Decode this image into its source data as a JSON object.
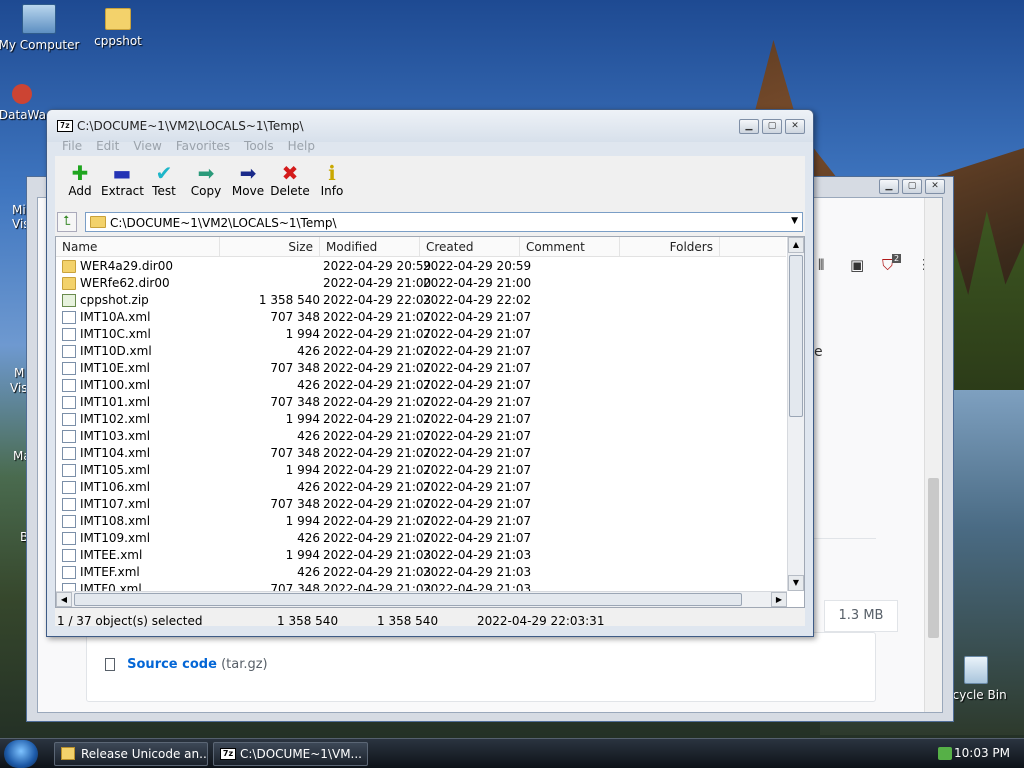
{
  "desktop": {
    "icons": [
      {
        "label": "My Computer",
        "icon": "computer-icon"
      },
      {
        "label": "cppshot",
        "icon": "folder-icon"
      },
      {
        "label": "DataWa",
        "icon": "app-icon"
      },
      {
        "label": "ecycle Bin",
        "icon": "recycle-bin-icon"
      }
    ],
    "partial_labels": [
      "Mi",
      "Vis",
      "M",
      "Vis",
      "Ma",
      "B"
    ]
  },
  "background_window": {
    "size_label": "1.3 MB",
    "source_code_label": "Source code",
    "source_code_type": "(tar.gz)",
    "cut_text": "e",
    "badge": "2"
  },
  "window": {
    "title": "C:\\DOCUME~1\\VM2\\LOCALS~1\\Temp\\",
    "app_icon_text": "7z",
    "menu": [
      "File",
      "Edit",
      "View",
      "Favorites",
      "Tools",
      "Help"
    ],
    "toolbar": [
      {
        "label": "Add",
        "icon": "plus-icon",
        "glyph": "✚",
        "color": "#1fa51f"
      },
      {
        "label": "Extract",
        "icon": "minus-icon",
        "glyph": "▬",
        "color": "#2433b5"
      },
      {
        "label": "Test",
        "icon": "check-icon",
        "glyph": "✔",
        "color": "#1eb6c9"
      },
      {
        "label": "Copy",
        "icon": "copy-arrow-icon",
        "glyph": "➡",
        "color": "#2a9a7a"
      },
      {
        "label": "Move",
        "icon": "move-arrow-icon",
        "glyph": "➡",
        "color": "#1a2a8a"
      },
      {
        "label": "Delete",
        "icon": "delete-x-icon",
        "glyph": "✖",
        "color": "#d41b1b"
      },
      {
        "label": "Info",
        "icon": "info-icon",
        "glyph": "ℹ",
        "color": "#c9a800"
      }
    ],
    "address": "C:\\DOCUME~1\\VM2\\LOCALS~1\\Temp\\",
    "columns": [
      "Name",
      "Size",
      "Modified",
      "Created",
      "Comment",
      "Folders"
    ],
    "files": [
      {
        "name": "WER4a29.dir00",
        "type": "folder",
        "size": "",
        "modified": "2022-04-29 20:59",
        "created": "2022-04-29 20:59"
      },
      {
        "name": "WERfe62.dir00",
        "type": "folder",
        "size": "",
        "modified": "2022-04-29 21:00",
        "created": "2022-04-29 21:00"
      },
      {
        "name": "cppshot.zip",
        "type": "zip",
        "size": "1 358 540",
        "modified": "2022-04-29 22:03",
        "created": "2022-04-29 22:02"
      },
      {
        "name": "IMT10A.xml",
        "type": "xml",
        "size": "707 348",
        "modified": "2022-04-29 21:07",
        "created": "2022-04-29 21:07"
      },
      {
        "name": "IMT10C.xml",
        "type": "xml",
        "size": "1 994",
        "modified": "2022-04-29 21:07",
        "created": "2022-04-29 21:07"
      },
      {
        "name": "IMT10D.xml",
        "type": "xml",
        "size": "426",
        "modified": "2022-04-29 21:07",
        "created": "2022-04-29 21:07"
      },
      {
        "name": "IMT10E.xml",
        "type": "xml",
        "size": "707 348",
        "modified": "2022-04-29 21:07",
        "created": "2022-04-29 21:07"
      },
      {
        "name": "IMT100.xml",
        "type": "xml",
        "size": "426",
        "modified": "2022-04-29 21:07",
        "created": "2022-04-29 21:07"
      },
      {
        "name": "IMT101.xml",
        "type": "xml",
        "size": "707 348",
        "modified": "2022-04-29 21:07",
        "created": "2022-04-29 21:07"
      },
      {
        "name": "IMT102.xml",
        "type": "xml",
        "size": "1 994",
        "modified": "2022-04-29 21:07",
        "created": "2022-04-29 21:07"
      },
      {
        "name": "IMT103.xml",
        "type": "xml",
        "size": "426",
        "modified": "2022-04-29 21:07",
        "created": "2022-04-29 21:07"
      },
      {
        "name": "IMT104.xml",
        "type": "xml",
        "size": "707 348",
        "modified": "2022-04-29 21:07",
        "created": "2022-04-29 21:07"
      },
      {
        "name": "IMT105.xml",
        "type": "xml",
        "size": "1 994",
        "modified": "2022-04-29 21:07",
        "created": "2022-04-29 21:07"
      },
      {
        "name": "IMT106.xml",
        "type": "xml",
        "size": "426",
        "modified": "2022-04-29 21:07",
        "created": "2022-04-29 21:07"
      },
      {
        "name": "IMT107.xml",
        "type": "xml",
        "size": "707 348",
        "modified": "2022-04-29 21:07",
        "created": "2022-04-29 21:07"
      },
      {
        "name": "IMT108.xml",
        "type": "xml",
        "size": "1 994",
        "modified": "2022-04-29 21:07",
        "created": "2022-04-29 21:07"
      },
      {
        "name": "IMT109.xml",
        "type": "xml",
        "size": "426",
        "modified": "2022-04-29 21:07",
        "created": "2022-04-29 21:07"
      },
      {
        "name": "IMTEE.xml",
        "type": "xml",
        "size": "1 994",
        "modified": "2022-04-29 21:03",
        "created": "2022-04-29 21:03"
      },
      {
        "name": "IMTEF.xml",
        "type": "xml",
        "size": "426",
        "modified": "2022-04-29 21:03",
        "created": "2022-04-29 21:03"
      },
      {
        "name": "IMTF0.xml",
        "type": "xml",
        "size": "707 348",
        "modified": "2022-04-29 21:03",
        "created": "2022-04-29 21:03"
      }
    ],
    "status": {
      "selection": "1 / 37 object(s) selected",
      "size": "1 358 540",
      "packed": "1 358 540",
      "date": "2022-04-29 22:03:31"
    }
  },
  "taskbar": {
    "buttons": [
      "Release Unicode an...",
      "C:\\DOCUME~1\\VM..."
    ],
    "clock": "10:03 PM"
  }
}
